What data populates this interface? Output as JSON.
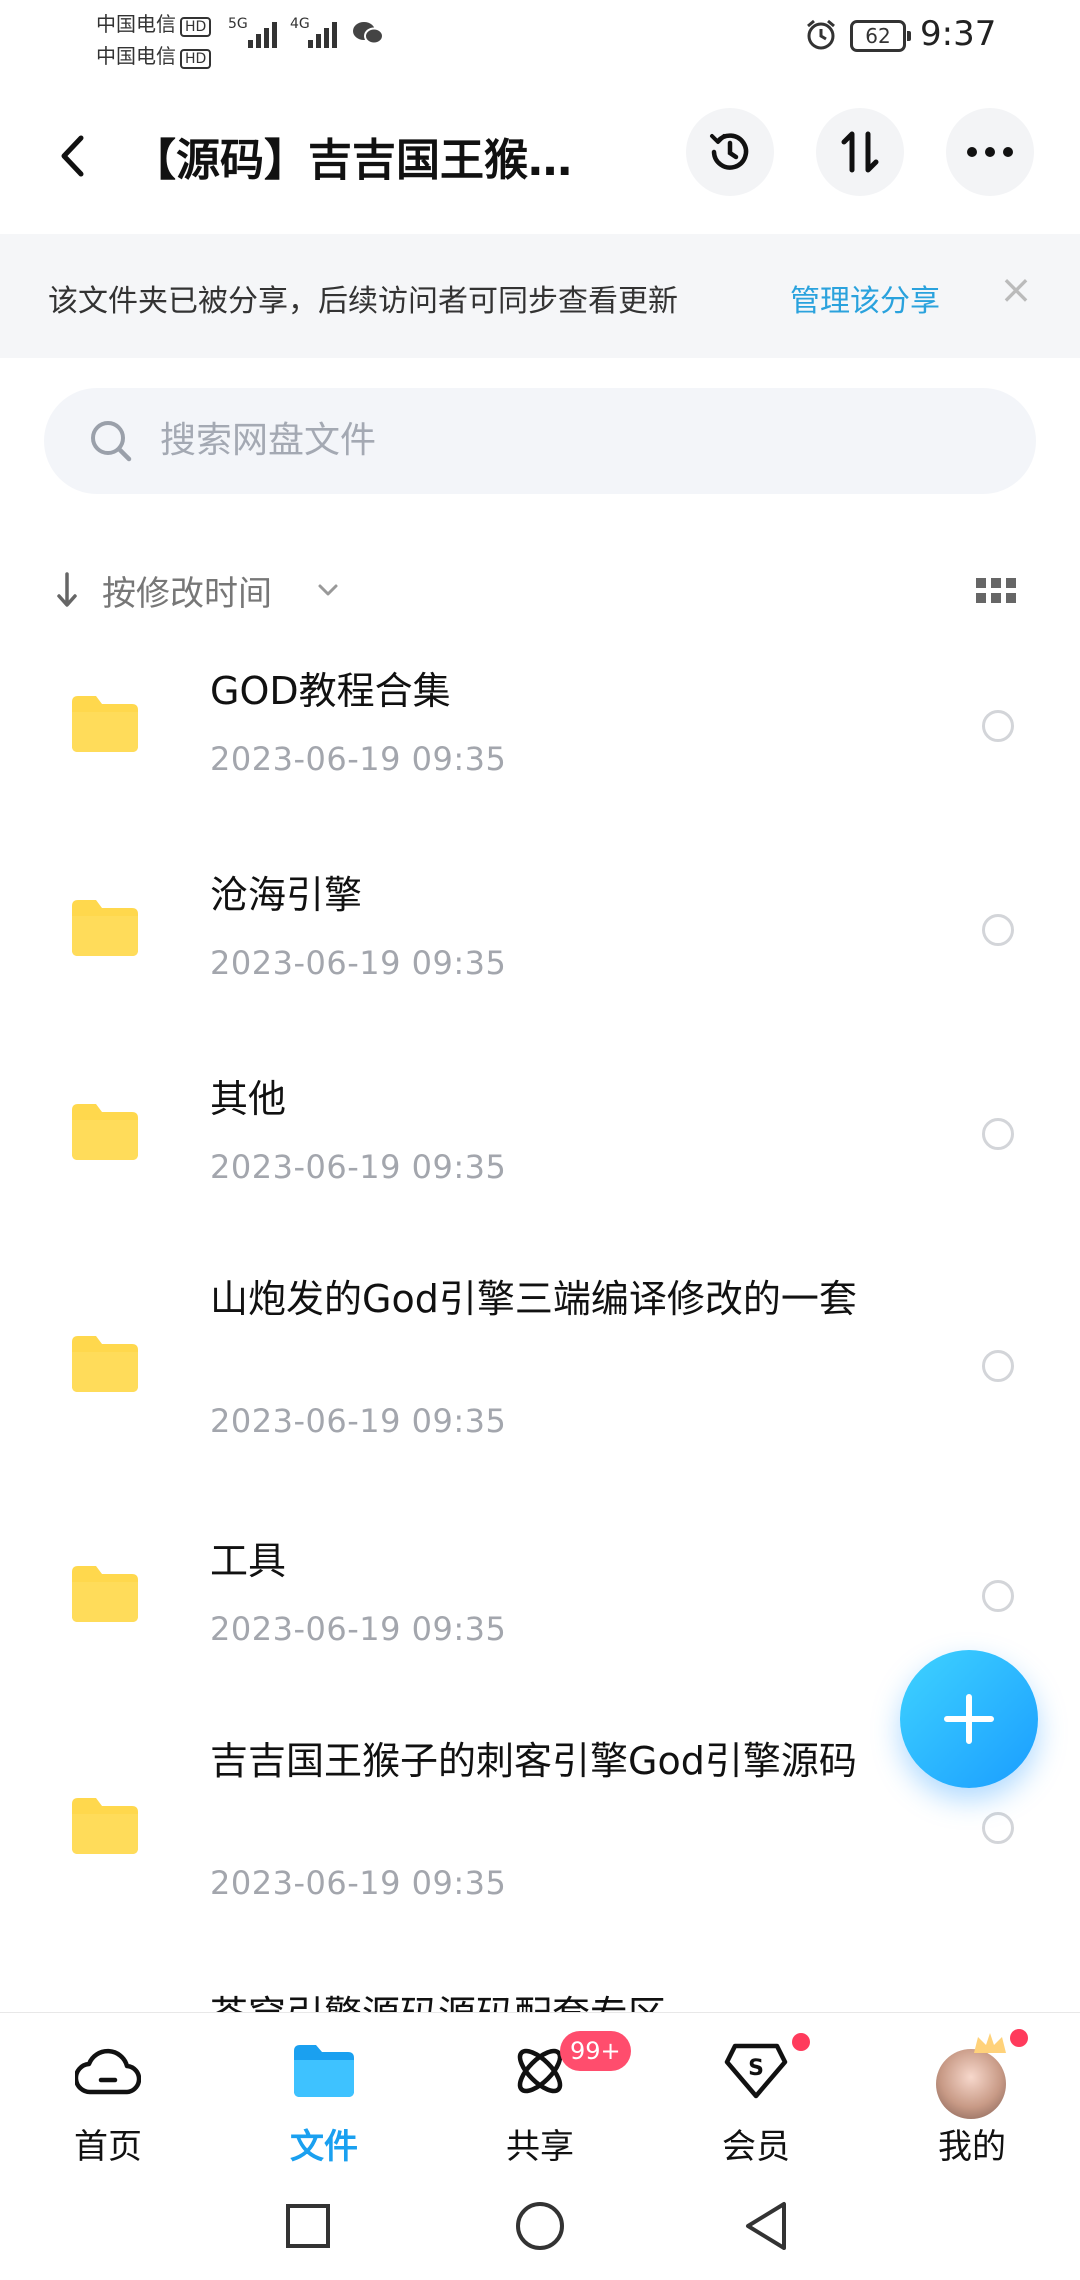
{
  "status_bar": {
    "carrier_1": "中国电信",
    "carrier_2": "中国电信",
    "hd": "HD",
    "net_1": "5G",
    "net_2": "4G",
    "battery": "62",
    "time": "9:37"
  },
  "header": {
    "title": "【源码】吉吉国王猴子的刺客引擎God引擎源码"
  },
  "notice": {
    "text": "该文件夹已被分享，后续访问者可同步查看更新",
    "link": "管理该分享"
  },
  "search": {
    "placeholder": "搜索网盘文件"
  },
  "sort": {
    "label": "按修改时间"
  },
  "files": [
    {
      "name": "GOD教程合集",
      "time": "2023-06-19  09:35"
    },
    {
      "name": "沧海引擎",
      "time": "2023-06-19  09:35"
    },
    {
      "name": "其他",
      "time": "2023-06-19  09:35"
    },
    {
      "name": "山炮发的God引擎三端编译修改的一套",
      "time": "2023-06-19  09:35"
    },
    {
      "name": "工具",
      "time": "2023-06-19  09:35"
    },
    {
      "name": "吉吉国王猴子的刺客引擎God引擎源码",
      "time": "2023-06-19  09:35"
    },
    {
      "name": "苍穹引擎源码源码配套专区",
      "time": ""
    }
  ],
  "nav": {
    "items": [
      {
        "label": "首页"
      },
      {
        "label": "文件"
      },
      {
        "label": "共享"
      },
      {
        "label": "会员"
      },
      {
        "label": "我的"
      }
    ],
    "share_badge": "99+"
  },
  "colors": {
    "accent": "#1aa0f0",
    "link": "#2aa2dd",
    "folder": "#ffd84d",
    "badge": "#ff4d6d"
  }
}
